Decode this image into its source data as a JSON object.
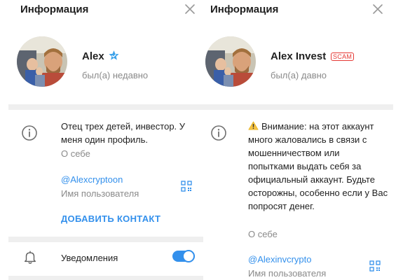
{
  "left_panel": {
    "header_title": "Информация",
    "profile": {
      "name": "Alex",
      "last_seen": "был(а) недавно",
      "verified_icon": "verified-star-icon"
    },
    "about": {
      "text": "Отец трех детей, инвестор. У меня один профиль.",
      "caption": "О себе"
    },
    "username": {
      "value": "@Alexcryptoon",
      "caption": "Имя пользователя"
    },
    "add_contact_label": "ДОБАВИТЬ КОНТАКТ",
    "notifications": {
      "label": "Уведомления",
      "enabled": true
    }
  },
  "right_panel": {
    "header_title": "Информация",
    "profile": {
      "name": "Alex Invest",
      "badge": "SCAM",
      "last_seen": "был(а) давно"
    },
    "about": {
      "text": "Внимание: на этот аккаунт много жаловались в связи с мошенничеством или попытками выдать себя за официальный аккаунт. Будьте осторожны, особенно если у Вас попросят денег.",
      "caption": "О себе"
    },
    "username": {
      "value": "@Alexinvcrypto",
      "caption": "Имя пользователя"
    }
  },
  "colors": {
    "accent": "#3390ec",
    "scam": "#e53935",
    "secondary_text": "#8a8a8a",
    "section_divider": "#efefef",
    "warning": "#f6c342"
  }
}
